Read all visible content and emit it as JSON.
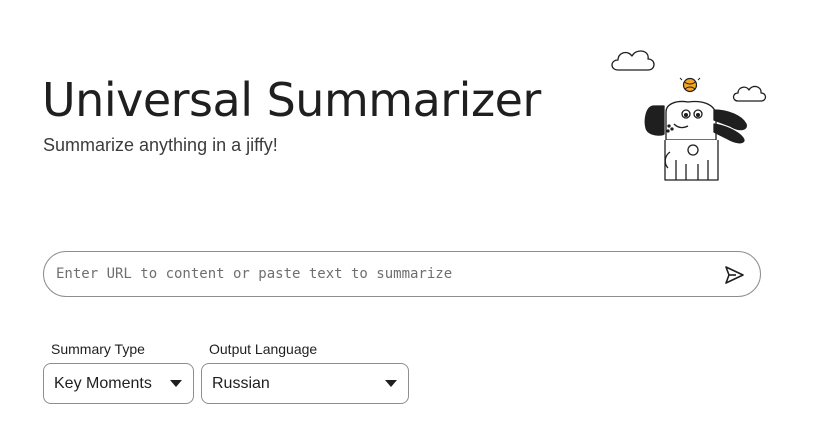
{
  "header": {
    "title": "Universal Summarizer",
    "subtitle": "Summarize anything in a jiffy!"
  },
  "illustration": {
    "icon": "dog-mascot-icon",
    "ball_color": "#f5a623"
  },
  "url_bar": {
    "value": "",
    "placeholder": "Enter URL to content or paste text to summarize",
    "submit_icon": "send-arrow-icon"
  },
  "summary_type": {
    "label": "Summary Type",
    "selected": "Key Moments"
  },
  "output_language": {
    "label": "Output Language",
    "selected": "Russian"
  }
}
